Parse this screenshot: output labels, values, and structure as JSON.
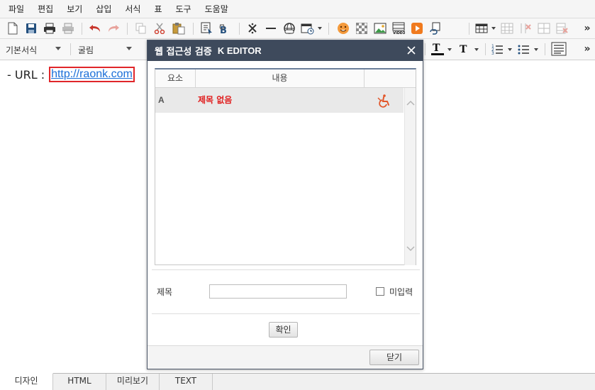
{
  "menu": {
    "items": [
      "파일",
      "편집",
      "보기",
      "삽입",
      "서식",
      "표",
      "도구",
      "도움말"
    ]
  },
  "toolbar": {
    "icons": [
      "new-document-icon",
      "save-icon",
      "print-icon",
      "print-preview-icon",
      "undo-icon",
      "redo-icon",
      "copy-icon",
      "cut-icon",
      "paste-icon",
      "select-all-icon",
      "find-replace-icon",
      "special-char-icon",
      "horizontal-rule-icon",
      "link-icon",
      "date-icon",
      "emoticon-icon",
      "background-icon",
      "image-icon",
      "video-icon",
      "media-icon",
      "hyperlink-icon",
      "table-icon",
      "table-insert-icon",
      "table-delete-icon",
      "cell-merge-icon",
      "cell-delete-icon",
      "more-icon"
    ],
    "more_label": "»"
  },
  "format": {
    "paragraph_style": "기본서식",
    "font_name": "굴림",
    "more_label": "»"
  },
  "editor": {
    "prefix": "- URL : ",
    "link_text": "http://raonk.com"
  },
  "dialog": {
    "title": "웹 접근성 검증",
    "brand": "K EDITOR",
    "columns": [
      "요소",
      "내용",
      ""
    ],
    "rows": [
      {
        "element": "A",
        "content": "제목 없음",
        "icon": "accessibility-wheelchair-icon"
      }
    ],
    "field_label": "제목",
    "field_value": "",
    "checkbox_label": "미입력",
    "confirm_label": "확인",
    "close_label": "닫기",
    "accent": "#3e4a5c",
    "error_color": "#e01b1b"
  },
  "tabs": [
    {
      "label": "디자인",
      "active": true
    },
    {
      "label": "HTML",
      "active": false
    },
    {
      "label": "미리보기",
      "active": false
    },
    {
      "label": "TEXT",
      "active": false
    }
  ]
}
